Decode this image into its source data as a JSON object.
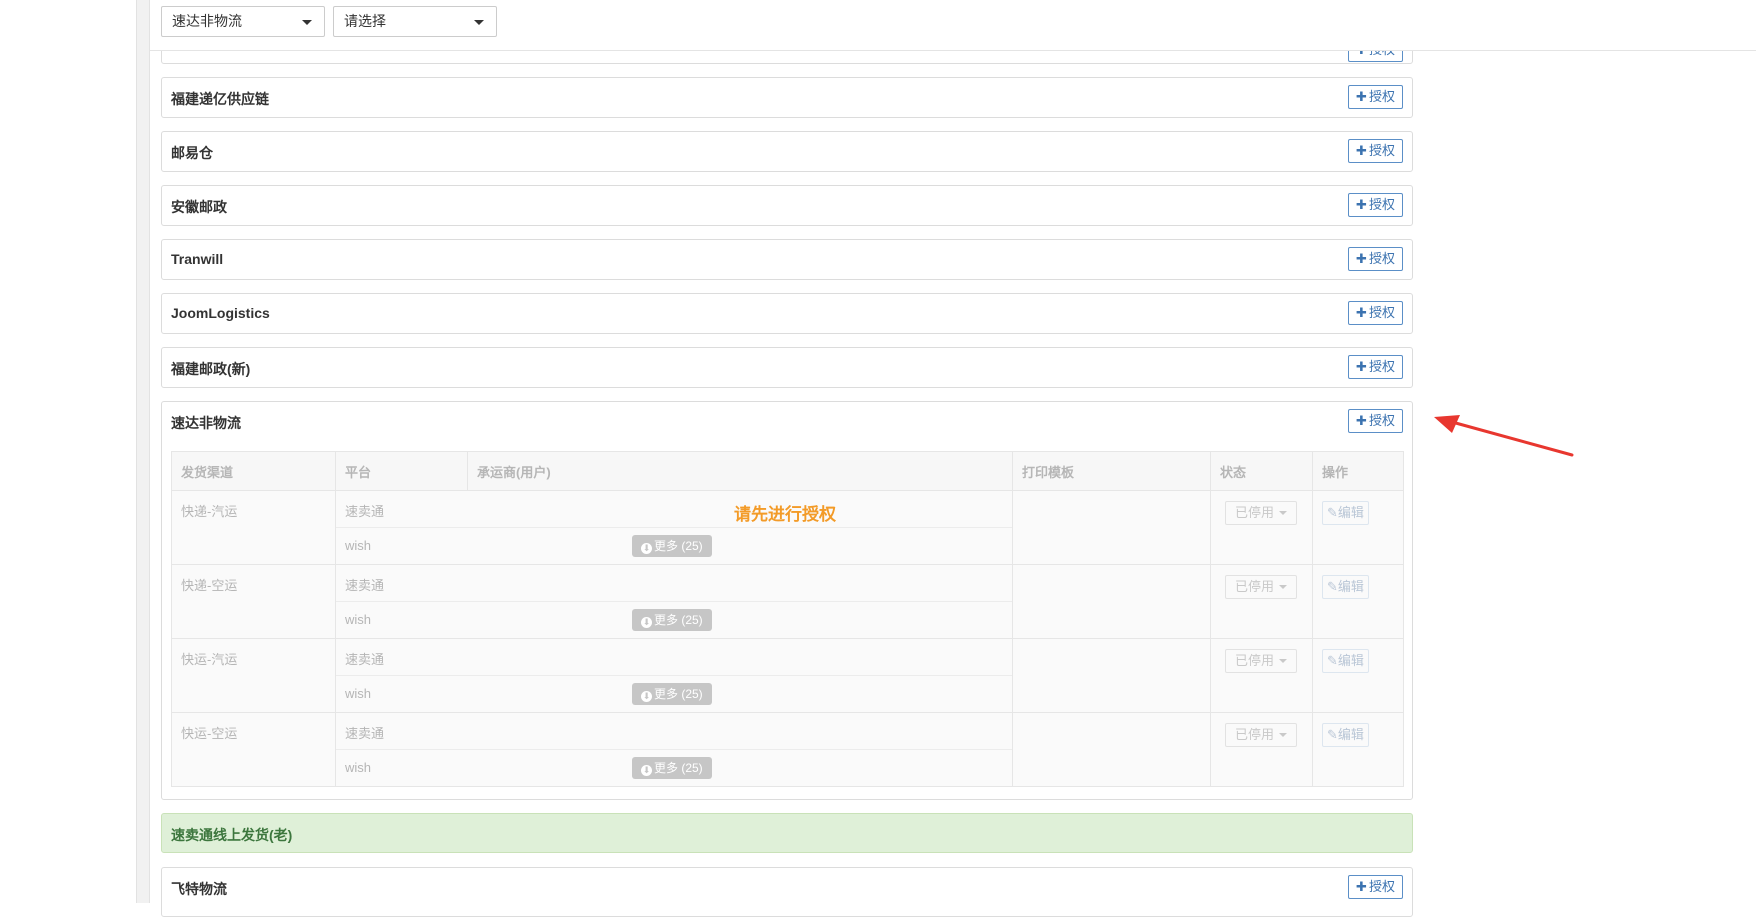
{
  "filters": {
    "carrier_select": "速达非物流",
    "second_select": "请选择"
  },
  "auth_label": "授权",
  "panels": [
    {
      "title": "福建递亿供应链"
    },
    {
      "title": "邮易仓"
    },
    {
      "title": "安徽邮政"
    },
    {
      "title": "Tranwill"
    },
    {
      "title": "JoomLogistics"
    },
    {
      "title": "福建邮政(新)"
    }
  ],
  "expanded_panel": {
    "title": "速达非物流",
    "notice": "请先进行授权",
    "columns": [
      "发货渠道",
      "平台",
      "承运商(用户)",
      "打印模板",
      "状态",
      "操作"
    ],
    "rows": [
      {
        "channel": "快递-汽运",
        "platforms": [
          "速卖通",
          "wish"
        ],
        "more": "更多 (25)",
        "status": "已停用",
        "action": "编辑"
      },
      {
        "channel": "快递-空运",
        "platforms": [
          "速卖通",
          "wish"
        ],
        "more": "更多 (25)",
        "status": "已停用",
        "action": "编辑"
      },
      {
        "channel": "快运-汽运",
        "platforms": [
          "速卖通",
          "wish"
        ],
        "more": "更多 (25)",
        "status": "已停用",
        "action": "编辑"
      },
      {
        "channel": "快运-空运",
        "platforms": [
          "速卖通",
          "wish"
        ],
        "more": "更多 (25)",
        "status": "已停用",
        "action": "编辑"
      }
    ]
  },
  "success_panel": {
    "title": "速卖通线上发货(老)"
  },
  "last_panel": {
    "title": "飞特物流"
  },
  "colors": {
    "auth_border": "#5b8fc7",
    "notice": "#f39b28",
    "arrow": "#e8372f",
    "success_bg": "#dff0d8"
  }
}
